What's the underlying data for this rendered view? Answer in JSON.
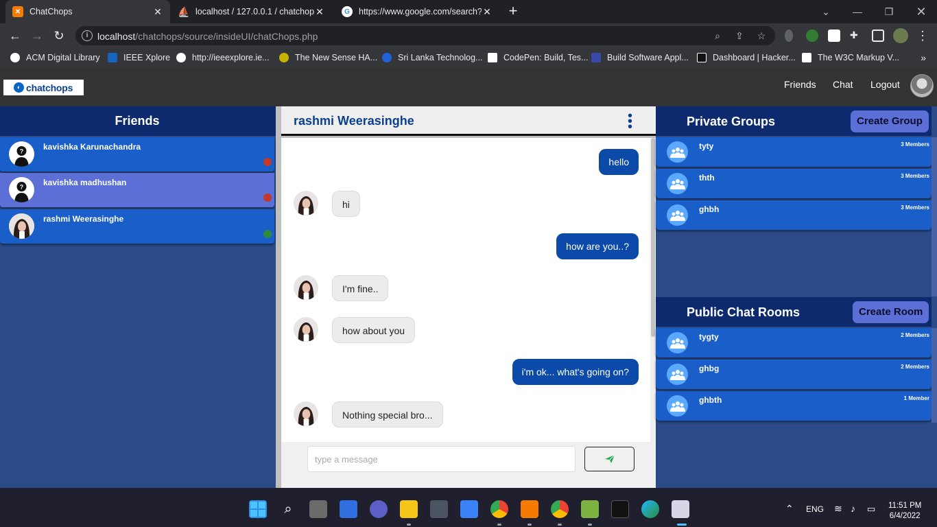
{
  "browser": {
    "tabs": [
      {
        "title": "ChatChops",
        "active": true
      },
      {
        "title": "localhost / 127.0.0.1 / chatchops",
        "active": false
      },
      {
        "title": "https://www.google.com/search?",
        "active": false
      }
    ],
    "url_host": "localhost",
    "url_path": "/chatchops/source/insideUI/chatChops.php",
    "bookmarks": [
      "ACM Digital Library",
      "IEEE Xplore",
      "http://ieeexplore.ie...",
      "The New Sense HA...",
      "Sri Lanka Technolog...",
      "CodePen: Build, Tes...",
      "Build Software Appl...",
      "Dashboard | Hacker...",
      "The W3C Markup V..."
    ]
  },
  "app": {
    "logo_text": "chatchops",
    "nav": {
      "friends": "Friends",
      "chat": "Chat",
      "logout": "Logout"
    },
    "friends_panel": {
      "title": "Friends",
      "items": [
        {
          "name": "kavishka Karunachandra",
          "status_color": "#c0392b"
        },
        {
          "name": "kavishka madhushan",
          "status_color": "#c0392b"
        },
        {
          "name": "rashmi Weerasinghe",
          "status_color": "#2e8b3e"
        }
      ]
    },
    "chat": {
      "contact_name": "rashmi Weerasinghe",
      "messages": [
        {
          "dir": "out",
          "text": "hello"
        },
        {
          "dir": "in",
          "text": "hi"
        },
        {
          "dir": "out",
          "text": "how are you..?"
        },
        {
          "dir": "in",
          "text": "I'm fine.."
        },
        {
          "dir": "in",
          "text": "how about you"
        },
        {
          "dir": "out",
          "text": "i'm ok... what's going on?"
        },
        {
          "dir": "in",
          "text": "Nothing special bro..."
        }
      ],
      "input_placeholder": "type a message"
    },
    "private_groups": {
      "title": "Private Groups",
      "button": "Create Group",
      "items": [
        {
          "name": "tyty",
          "members": "3 Members"
        },
        {
          "name": "thth",
          "members": "3 Members"
        },
        {
          "name": "ghbh",
          "members": "3 Members"
        }
      ]
    },
    "public_rooms": {
      "title": "Public Chat Rooms",
      "button": "Create Room",
      "items": [
        {
          "name": "tygty",
          "members": "2 Members"
        },
        {
          "name": "ghbg",
          "members": "2 Members"
        },
        {
          "name": "ghbth",
          "members": "1 Member"
        }
      ]
    }
  },
  "taskbar": {
    "language": "ENG",
    "time": "11:51 PM",
    "date": "6/4/2022"
  }
}
